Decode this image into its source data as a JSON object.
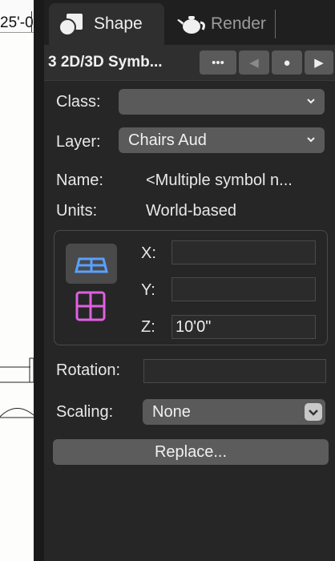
{
  "drawing": {
    "ruler_label": "25'-0"
  },
  "tabs": [
    {
      "label": "Shape",
      "icon": "shapes-icon",
      "active": true
    },
    {
      "label": "Render",
      "icon": "teapot-icon",
      "active": false
    }
  ],
  "object_bar": {
    "title": "3 2D/3D Symb...",
    "menu_label": "•••",
    "prev_label": "◀",
    "dot_label": "●",
    "next_label": "▶"
  },
  "class_row": {
    "label": "Class:",
    "value": ""
  },
  "layer_row": {
    "label": "Layer:",
    "value": "Chairs Aud"
  },
  "name_row": {
    "label": "Name:",
    "value": "<Multiple symbol n..."
  },
  "units_row": {
    "label": "Units:",
    "value": "World-based"
  },
  "position": {
    "x_label": "X:",
    "x_value": "",
    "y_label": "Y:",
    "y_value": "",
    "z_label": "Z:",
    "z_value": "10'0\""
  },
  "rotation_row": {
    "label": "Rotation:",
    "value": ""
  },
  "scaling_row": {
    "label": "Scaling:",
    "value": "None"
  },
  "replace_label": "Replace...",
  "colors": {
    "panel_bg": "#262626",
    "control_bg": "#5a5a5a",
    "top_view_blue": "#5aa0ff",
    "plan_view_pink": "#e060e0"
  }
}
